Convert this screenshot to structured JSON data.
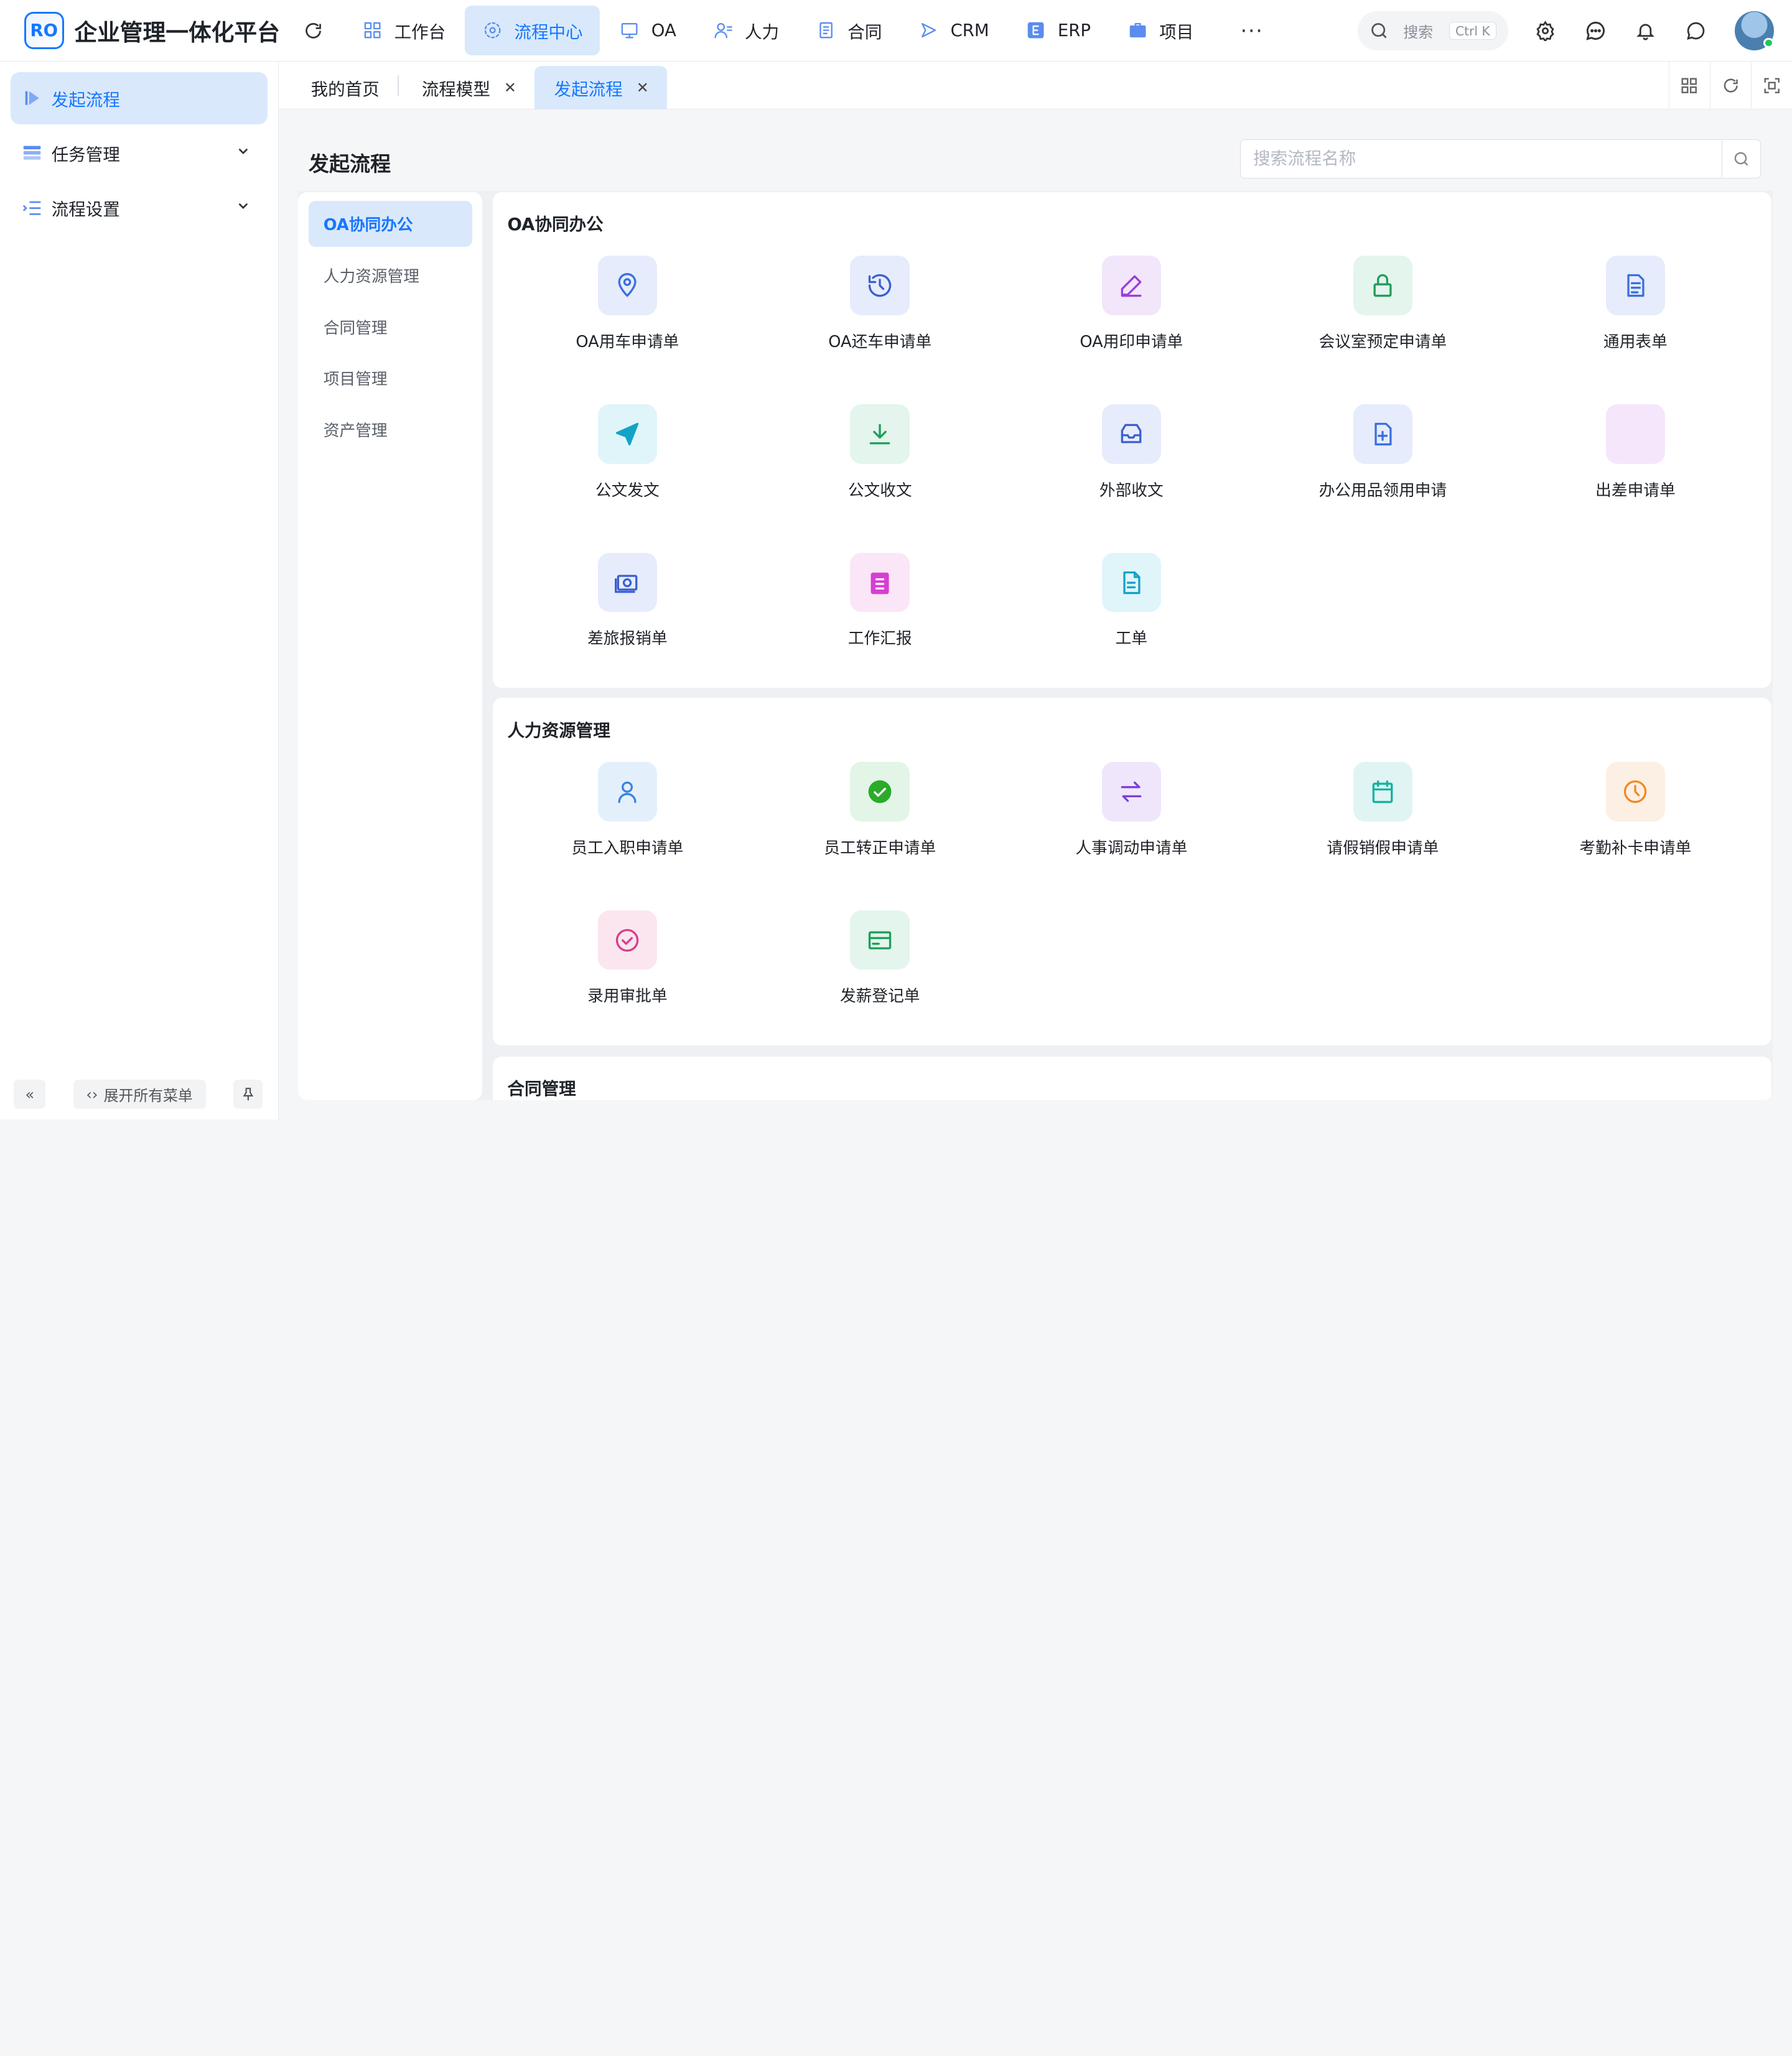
{
  "app": {
    "logo_text": "RO",
    "title": "企业管理一体化平台"
  },
  "topnav": [
    {
      "label": "工作台",
      "icon": "dashboard-icon"
    },
    {
      "label": "流程中心",
      "icon": "workflow-icon",
      "active": true
    },
    {
      "label": "OA",
      "icon": "oa-icon"
    },
    {
      "label": "人力",
      "icon": "people-icon"
    },
    {
      "label": "合同",
      "icon": "contract-icon"
    },
    {
      "label": "CRM",
      "icon": "crm-icon"
    },
    {
      "label": "ERP",
      "icon": "erp-icon"
    },
    {
      "label": "项目",
      "icon": "project-icon"
    }
  ],
  "search": {
    "placeholder": "搜索",
    "shortcut": "Ctrl K"
  },
  "sidebar": {
    "items": [
      {
        "label": "发起流程",
        "icon": "play-icon",
        "active": true
      },
      {
        "label": "任务管理",
        "icon": "task-list-icon"
      },
      {
        "label": "流程设置",
        "icon": "settings-list-icon"
      }
    ],
    "expand_all_label": "展开所有菜单"
  },
  "tabs": [
    {
      "label": "我的首页",
      "closable": false
    },
    {
      "label": "流程模型",
      "closable": true
    },
    {
      "label": "发起流程",
      "closable": true,
      "active": true
    }
  ],
  "page": {
    "title": "发起流程",
    "search_placeholder": "搜索流程名称",
    "categories": [
      {
        "label": "OA协同办公",
        "active": true
      },
      {
        "label": "人力资源管理"
      },
      {
        "label": "合同管理"
      },
      {
        "label": "项目管理"
      },
      {
        "label": "资产管理"
      }
    ],
    "groups": [
      {
        "title": "OA协同办公",
        "items": [
          {
            "label": "OA用车申请单",
            "icon": "location-pin-icon",
            "bg": "#e6ecfb",
            "color": "#3b6fe0"
          },
          {
            "label": "OA还车申请单",
            "icon": "history-icon",
            "bg": "#e6ecfb",
            "color": "#3b5fd0"
          },
          {
            "label": "OA用印申请单",
            "icon": "pen-icon",
            "bg": "#f2e6fb",
            "color": "#9b3fd9"
          },
          {
            "label": "会议室预定申请单",
            "icon": "lock-icon",
            "bg": "#e3f5ec",
            "color": "#1e9e5a"
          },
          {
            "label": "通用表单",
            "icon": "document-icon",
            "bg": "#e6ecfb",
            "color": "#3b6fe0"
          },
          {
            "label": "公文发文",
            "icon": "send-icon",
            "bg": "#e0f5fa",
            "color": "#13a3c7"
          },
          {
            "label": "公文收文",
            "icon": "download-icon",
            "bg": "#e3f5ec",
            "color": "#1e9e5a"
          },
          {
            "label": "外部收文",
            "icon": "inbox-icon",
            "bg": "#e6ecfb",
            "color": "#3b5fd0"
          },
          {
            "label": "办公用品领用申请",
            "icon": "file-add-icon",
            "bg": "#e6ecfb",
            "color": "#3b6fe0"
          },
          {
            "label": "出差申请单",
            "icon": "blank-icon",
            "bg": "#f6e6fb",
            "color": "#c04fd9"
          },
          {
            "label": "差旅报销单",
            "icon": "money-icon",
            "bg": "#e6ecfb",
            "color": "#3b5fd0"
          },
          {
            "label": "工作汇报",
            "icon": "clipboard-icon",
            "bg": "#fbe6f7",
            "color": "#d63fd0"
          },
          {
            "label": "工单",
            "icon": "file-text-icon",
            "bg": "#e0f5fa",
            "color": "#13a3c7"
          }
        ]
      },
      {
        "title": "人力资源管理",
        "items": [
          {
            "label": "员工入职申请单",
            "icon": "user-icon",
            "bg": "#e3f0fc",
            "color": "#3b82e0"
          },
          {
            "label": "员工转正申请单",
            "icon": "check-circle-icon",
            "bg": "#e3f5e6",
            "color": "#2aab2a"
          },
          {
            "label": "人事调动申请单",
            "icon": "swap-icon",
            "bg": "#efe6fb",
            "color": "#7b3fd9"
          },
          {
            "label": "请假销假申请单",
            "icon": "calendar-icon",
            "bg": "#e0f5f3",
            "color": "#13b3a3"
          },
          {
            "label": "考勤补卡申请单",
            "icon": "clock-icon",
            "bg": "#fcefe3",
            "color": "#f08a24"
          },
          {
            "label": "录用审批单",
            "icon": "check-badge-icon",
            "bg": "#fbe6ef",
            "color": "#d63f8a"
          },
          {
            "label": "发薪登记单",
            "icon": "card-icon",
            "bg": "#e3f5ec",
            "color": "#1e9e5a"
          }
        ]
      },
      {
        "title": "合同管理",
        "items": []
      }
    ]
  }
}
